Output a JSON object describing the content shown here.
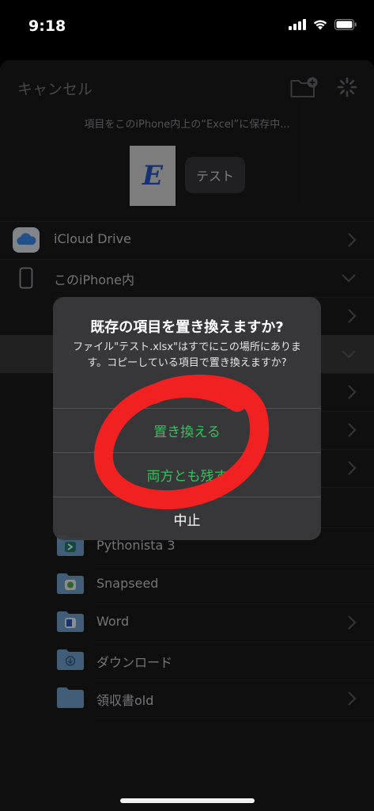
{
  "status": {
    "time": "9:18"
  },
  "header": {
    "cancel_label": "キャンセル",
    "save_caption": "項目をこのiPhone内上の“Excel”に保存中...",
    "file_icon_letter": "E",
    "file_name": "テスト"
  },
  "locations": [
    {
      "label": "iCloud Drive"
    },
    {
      "label": "このiPhone内"
    }
  ],
  "folders": [
    {
      "label": "Pythonista 3"
    },
    {
      "label": "Snapseed"
    },
    {
      "label": "Word"
    },
    {
      "label": "ダウンロード"
    },
    {
      "label": "領収書old"
    }
  ],
  "dialog": {
    "title": "既存の項目を置き換えますか?",
    "message": "ファイル\"テスト.xlsx\"はすでにこの場所にあります。コピーしている項目で置き換えますか?",
    "buttons": [
      "置き換える",
      "両方とも残す",
      "中止"
    ]
  },
  "colors": {
    "accent": "#32c35a",
    "folder_blue": "#6fa3cf",
    "scribble_red": "#ff1f1f"
  }
}
